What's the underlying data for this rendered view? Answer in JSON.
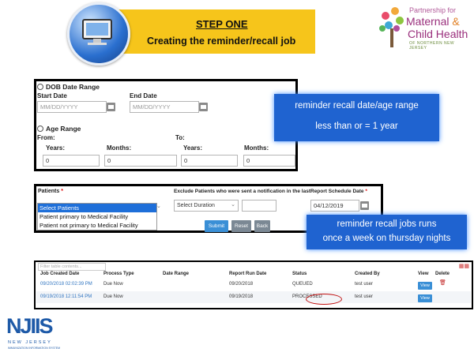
{
  "header": {
    "step_title": "STEP ONE",
    "step_subtitle": "Creating the reminder/recall job"
  },
  "partner_logo": {
    "line1": "Partnership for",
    "line2a": "Maternal ",
    "line2b": "&",
    "line3": "Child Health",
    "line4": "OF NORTHERN NEW JERSEY"
  },
  "dob_section": {
    "radio_label": "DOB Date Range",
    "start_label": "Start Date",
    "end_label": "End Date",
    "start_placeholder": "MM/DD/YYYY",
    "end_placeholder": "MM/DD/YYYY"
  },
  "age_section": {
    "radio_label": "Age Range",
    "from_label": "From:",
    "to_label": "To:",
    "from_years_label": "Years:",
    "from_months_label": "Months:",
    "to_years_label": "Years:",
    "to_months_label": "Months:",
    "from_years": "0",
    "from_months": "0",
    "to_years": "0",
    "to_months": "0"
  },
  "callouts": {
    "range_line1": "reminder recall date/age range",
    "range_line2": "less than or = 1 year",
    "schedule_line1": "reminder recall jobs runs",
    "schedule_line2": "once a week on thursday nights"
  },
  "patients_section": {
    "patients_label": "Patients",
    "required_mark": "*",
    "options": [
      "Select Patients",
      "Patient primary to Medical Facility",
      "Patient not primary to Medical Facility"
    ],
    "exclude_label": "Exclude Patients who were sent a notification in the last",
    "duration_value": "Select Duration",
    "schedule_label": "Report Schedule Date",
    "schedule_value": "04/12/2019",
    "submit_label": "Submit",
    "reset_label": "Reset",
    "back_label": "Back"
  },
  "jobs_table": {
    "filter_placeholder": "Filter table contents...",
    "columns": [
      "Job Created Date",
      "Process Type",
      "Date Range",
      "Report Run Date",
      "Status",
      "Created By",
      "View",
      "Delete"
    ],
    "rows": [
      {
        "created": "09/20/2018 02:02:39 PM",
        "process": "Due Now",
        "range": "",
        "run": "09/20/2018",
        "status": "QUEUED",
        "by": "test user",
        "view": "View"
      },
      {
        "created": "09/19/2018 12:11:54 PM",
        "process": "Due Now",
        "range": "",
        "run": "09/19/2018",
        "status": "PROCESSED",
        "by": "test user",
        "view": "View"
      }
    ]
  },
  "njiis_logo": {
    "letters": "NJIIS",
    "sub1": "NEW JERSEY",
    "sub2": "IMMUNIZATION INFORMATION SYSTEM"
  }
}
